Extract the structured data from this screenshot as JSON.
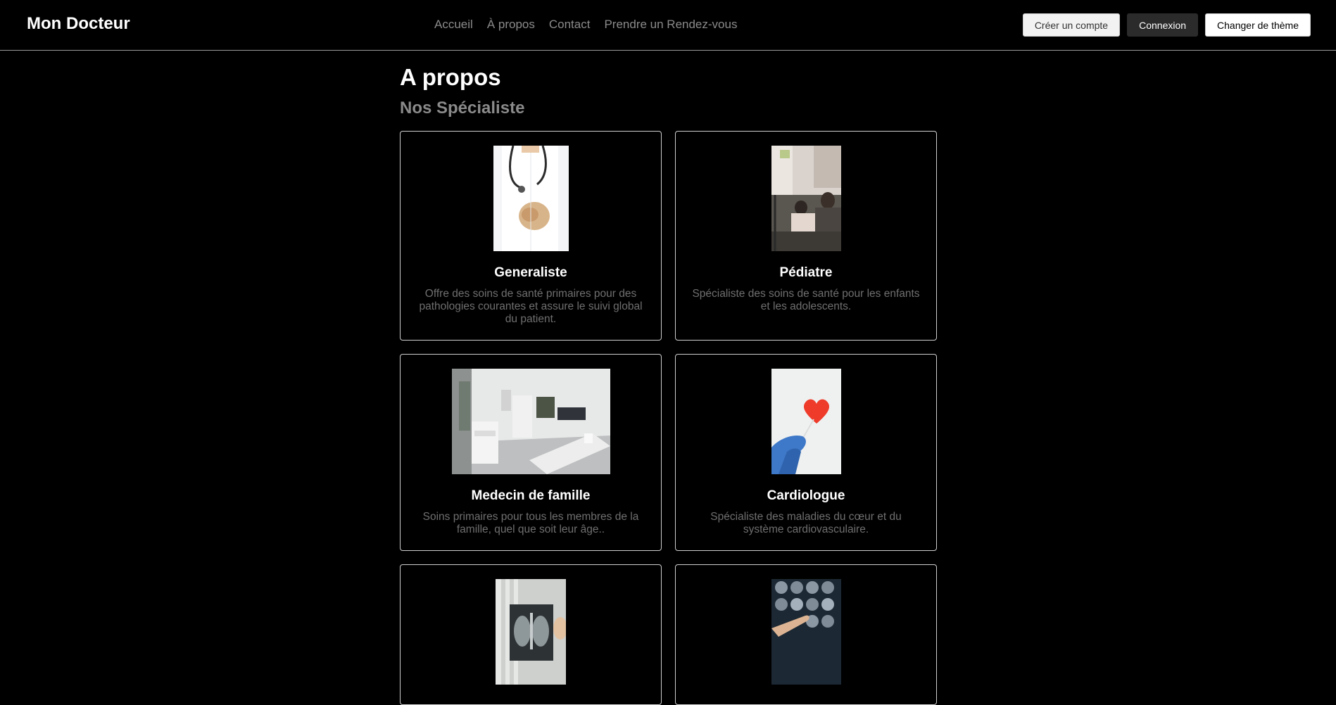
{
  "header": {
    "brand": "Mon Docteur",
    "nav": [
      "Accueil",
      "À propos",
      "Contact",
      "Prendre un Rendez-vous"
    ],
    "buttons": {
      "signup": "Créer un compte",
      "login": "Connexion",
      "theme": "Changer de thème"
    }
  },
  "main": {
    "title": "A propos",
    "subtitle": "Nos Spécialiste",
    "cards": [
      {
        "name": "Generaliste",
        "description": "Offre des soins de santé primaires pour des pathologies courantes et assure le suivi global du patient."
      },
      {
        "name": "Pédiatre",
        "description": "Spécialiste des soins de santé pour les enfants et les adolescents."
      },
      {
        "name": "Medecin de famille",
        "description": "Soins primaires pour tous les membres de la famille, quel que soit leur âge.."
      },
      {
        "name": "Cardiologue",
        "description": "Spécialiste des maladies du cœur et du système cardiovasculaire."
      },
      {
        "name": "",
        "description": ""
      },
      {
        "name": "",
        "description": ""
      }
    ]
  },
  "colors": {
    "background": "#000000",
    "nav_link": "#8a8a8a",
    "subtitle": "#8a8a8a",
    "card_border": "#cfcfcf",
    "description": "#6f6f6f"
  }
}
